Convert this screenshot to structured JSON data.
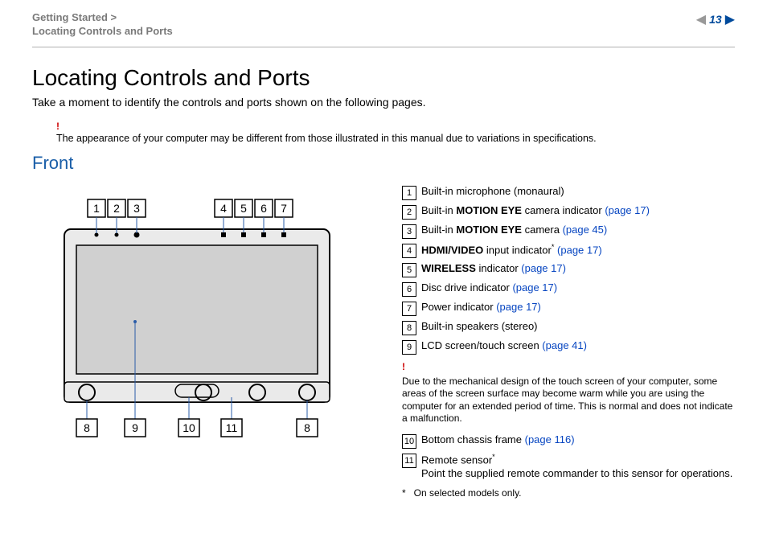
{
  "header": {
    "breadcrumb_line1": "Getting Started >",
    "breadcrumb_line2": "Locating Controls and Ports",
    "page_number": "13"
  },
  "title": "Locating Controls and Ports",
  "intro": "Take a moment to identify the controls and ports shown on the following pages.",
  "appearance_note": "The appearance of your computer may be different from those illustrated in this manual due to variations in specifications.",
  "section_heading": "Front",
  "items": [
    {
      "n": "1",
      "text": "Built-in microphone (monaural)"
    },
    {
      "n": "2",
      "pre": "Built-in ",
      "bold": "MOTION EYE",
      "post": " camera indicator ",
      "link": "(page 17)"
    },
    {
      "n": "3",
      "pre": "Built-in ",
      "bold": "MOTION EYE",
      "post": " camera ",
      "link": "(page 45)"
    },
    {
      "n": "4",
      "bold": "HDMI/VIDEO",
      "post": " input indicator",
      "sup": "*",
      "sp": " ",
      "link": "(page 17)"
    },
    {
      "n": "5",
      "bold": "WIRELESS",
      "post": " indicator ",
      "link": "(page 17)"
    },
    {
      "n": "6",
      "text": "Disc drive indicator ",
      "link": "(page 17)"
    },
    {
      "n": "7",
      "text": "Power indicator ",
      "link": "(page 17)"
    },
    {
      "n": "8",
      "text": "Built-in speakers (stereo)"
    },
    {
      "n": "9",
      "text": "LCD screen/touch screen ",
      "link": "(page 41)"
    }
  ],
  "warning": "Due to the mechanical design of the touch screen of your computer, some areas of the screen surface may become warm while you are using the computer for an extended period of time. This is normal and does not indicate a malfunction.",
  "item10": {
    "n": "10",
    "text": "Bottom chassis frame ",
    "link": "(page 116)"
  },
  "item11": {
    "n": "11",
    "label": "Remote sensor",
    "sup": "*",
    "desc": "Point the supplied remote commander to this sensor for operations."
  },
  "footnote": {
    "mark": "*",
    "text": "On selected models only."
  },
  "diagram_labels_top": [
    "1",
    "2",
    "3",
    "4",
    "5",
    "6",
    "7"
  ],
  "diagram_labels_bottom": [
    "8",
    "9",
    "10",
    "11",
    "8"
  ]
}
